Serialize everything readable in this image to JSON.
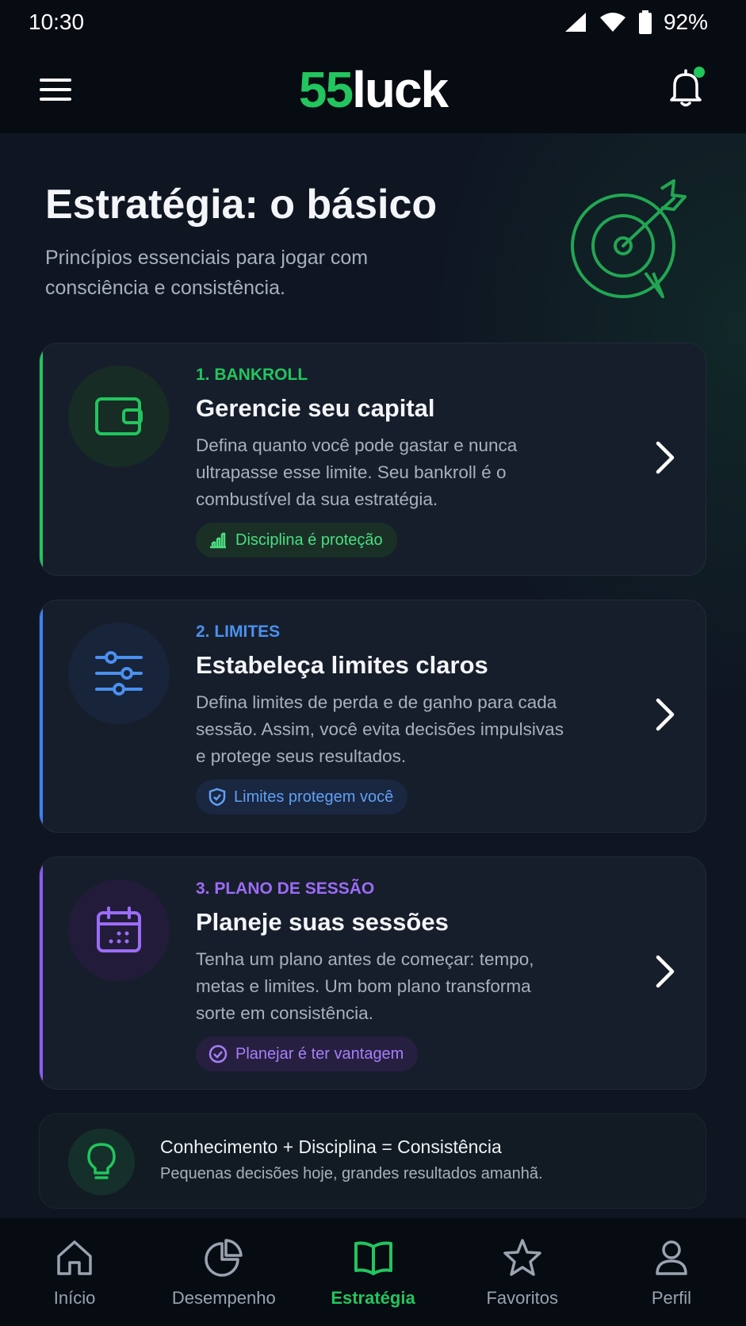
{
  "status": {
    "time": "10:30",
    "battery": "92%"
  },
  "header": {
    "logo_num": "55",
    "logo_word": "luck"
  },
  "page": {
    "title": "Estratégia: o básico",
    "subtitle": "Princípios essenciais para jogar com consciência e consistência."
  },
  "cards": [
    {
      "tag": "1. BANKROLL",
      "title": "Gerencie seu capital",
      "desc": "Defina quanto você pode gastar e nunca ultrapasse esse limite. Seu bankroll é o combustível da sua estratégia.",
      "chip": "Disciplina é proteção",
      "color": "#22c55e",
      "icon": "wallet-icon"
    },
    {
      "tag": "2. LIMITES",
      "title": "Estabeleça limites claros",
      "desc": "Defina limites de perda e de ganho para cada sessão. Assim, você evita decisões impulsivas e protege seus resultados.",
      "chip": "Limites protegem você",
      "color": "#3b82f6",
      "icon": "sliders-icon"
    },
    {
      "tag": "3. PLANO DE SESSÃO",
      "title": "Planeje suas sessões",
      "desc": "Tenha um plano antes de começar: tempo, metas e limites. Um bom plano transforma sorte em consistência.",
      "chip": "Planejar é ter vantagem",
      "color": "#8b5cf6",
      "icon": "calendar-icon"
    }
  ],
  "tip": {
    "title": "Conhecimento + Disciplina = Consistência",
    "subtitle": "Pequenas decisões hoje, grandes resultados amanhã."
  },
  "nav": [
    {
      "label": "Início",
      "icon": "home-icon",
      "active": false
    },
    {
      "label": "Desempenho",
      "icon": "pie-chart-icon",
      "active": false
    },
    {
      "label": "Estratégia",
      "icon": "book-icon",
      "active": true
    },
    {
      "label": "Favoritos",
      "icon": "star-icon",
      "active": false
    },
    {
      "label": "Perfil",
      "icon": "user-icon",
      "active": false
    }
  ],
  "colors": {
    "accent": "#22c55e",
    "background": "#0f1622",
    "card": "#171e2b"
  }
}
